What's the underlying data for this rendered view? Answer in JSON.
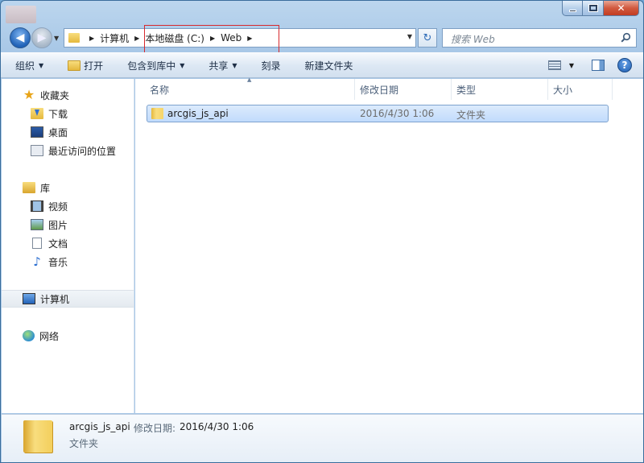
{
  "address": {
    "crumbs": [
      "计算机",
      "本地磁盘 (C:)",
      "Web"
    ]
  },
  "search": {
    "placeholder": "搜索 Web"
  },
  "toolbar": {
    "organize": "组织",
    "open": "打开",
    "include_library": "包含到库中",
    "share": "共享",
    "burn": "刻录",
    "new_folder": "新建文件夹"
  },
  "navpane": {
    "favorites": "收藏夹",
    "downloads": "下载",
    "desktop": "桌面",
    "recent": "最近访问的位置",
    "libraries": "库",
    "videos": "视频",
    "pictures": "图片",
    "documents": "文档",
    "music": "音乐",
    "computer": "计算机",
    "network": "网络"
  },
  "columns": {
    "name": "名称",
    "modified": "修改日期",
    "type": "类型",
    "size": "大小"
  },
  "files": [
    {
      "name": "arcgis_js_api",
      "modified": "2016/4/30 1:06",
      "type": "文件夹",
      "size": ""
    }
  ],
  "details": {
    "name": "arcgis_js_api",
    "modified_label": "修改日期:",
    "modified": "2016/4/30 1:06",
    "type": "文件夹"
  }
}
